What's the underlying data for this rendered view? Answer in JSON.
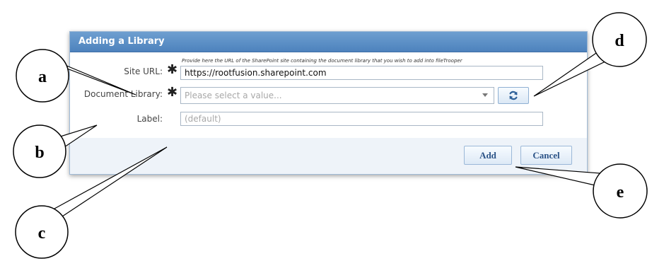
{
  "dialog": {
    "title": "Adding a Library",
    "hint": "Provide here the URL of the SharePoint site containing the document library that you wish to add into fileTrooper",
    "fields": {
      "site_url": {
        "label": "Site URL:",
        "value": "https://rootfusion.sharepoint.com",
        "required": true
      },
      "document_library": {
        "label": "Document Library:",
        "placeholder": "Please select a value...",
        "required": true
      },
      "label": {
        "label": "Label:",
        "placeholder": "(default)",
        "required": false
      }
    },
    "required_marker": "✱",
    "refresh_icon": "refresh-icon",
    "buttons": {
      "add": "Add",
      "cancel": "Cancel"
    }
  },
  "callouts": {
    "a": "a",
    "b": "b",
    "c": "c",
    "d": "d",
    "e": "e"
  },
  "colors": {
    "header": "#4d82bd",
    "button_text": "#2b5387",
    "dialog_bg": "#eef3f9"
  }
}
